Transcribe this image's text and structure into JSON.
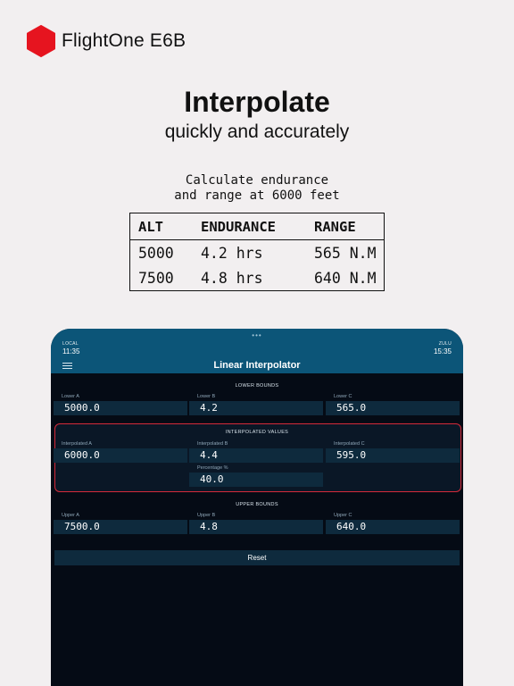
{
  "brand": {
    "name": "FlightOne E6B",
    "logo_color": "#e6141f",
    "logo_icon": "hexagon-icon"
  },
  "headline": "Interpolate",
  "subheadline": "quickly and accurately",
  "prompt": {
    "line1": "Calculate endurance",
    "line2": "and range at 6000 feet"
  },
  "table": {
    "headers": [
      "ALT",
      "ENDURANCE",
      "RANGE"
    ],
    "rows": [
      [
        "5000",
        "4.2 hrs",
        "565 N.M"
      ],
      [
        "7500",
        "4.8 hrs",
        "640 N.M"
      ]
    ]
  },
  "app": {
    "status": {
      "dots": "•••",
      "local_label": "LOCAL",
      "local_time": "11:35",
      "zulu_label": "ZULU",
      "zulu_time": "15:35"
    },
    "title": "Linear Interpolator",
    "menu_icon": "hamburger-menu-icon",
    "colors": {
      "header": "#0c5578",
      "background": "#050b15",
      "field": "#0e2a3d",
      "highlight": "#d52a3a"
    },
    "lower": {
      "title": "LOWER BOUNDS",
      "fields": [
        {
          "label": "Lower A",
          "value": "5000.0"
        },
        {
          "label": "Lower B",
          "value": "4.2"
        },
        {
          "label": "Lower C",
          "value": "565.0"
        }
      ]
    },
    "interpolated": {
      "title": "INTERPOLATED VALUES",
      "fields": [
        {
          "label": "Interpolated A",
          "value": "6000.0"
        },
        {
          "label": "Interpolated B",
          "value": "4.4"
        },
        {
          "label": "Interpolated C",
          "value": "595.0"
        }
      ],
      "percentage": {
        "label": "Percentage %",
        "value": "40.0"
      }
    },
    "upper": {
      "title": "UPPER BOUNDS",
      "fields": [
        {
          "label": "Upper A",
          "value": "7500.0"
        },
        {
          "label": "Upper B",
          "value": "4.8"
        },
        {
          "label": "Upper C",
          "value": "640.0"
        }
      ]
    },
    "reset_label": "Reset"
  }
}
